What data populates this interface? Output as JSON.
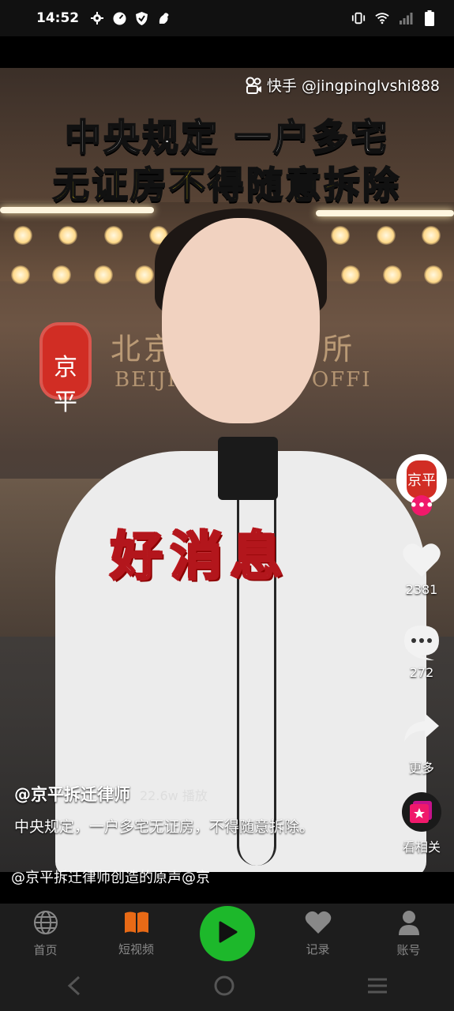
{
  "status_bar": {
    "time": "14:52",
    "left_icons": [
      "settings-icon",
      "speedometer-icon",
      "shield-icon",
      "bird-icon"
    ],
    "right_icons": [
      "vibrate-icon",
      "wifi-icon",
      "signal-icon",
      "battery-icon"
    ]
  },
  "video": {
    "platform_handle": "快手 @jingpinglvshi888",
    "title_line_1": "中央规定 一户多宅",
    "title_line_2": "无证房不得随意拆除",
    "overlay_words": "好消息",
    "wall_sign_cn": "北京   律师事务所",
    "wall_sign_en": "BEIJIN   NG LAW OFFI",
    "logo_text": "京平"
  },
  "actions": {
    "likes": "2381",
    "comments": "272",
    "share_label": "更多",
    "related_label": "看相关"
  },
  "caption": {
    "author": "@京平拆迁律师",
    "plays": "22.6w 播放",
    "description": "中央规定，一户多宅无证房，不得随意拆除。",
    "sound": "@京平拆迁律师创造的原声@京"
  },
  "tabbar": {
    "tabs": [
      {
        "label": "首页",
        "icon": "globe-icon"
      },
      {
        "label": "短视频",
        "icon": "book-icon"
      },
      {
        "label": "",
        "icon": "play-icon"
      },
      {
        "label": "记录",
        "icon": "heart-icon"
      },
      {
        "label": "账号",
        "icon": "person-icon"
      }
    ]
  },
  "colors": {
    "accent_green": "#1db82b",
    "accent_pink": "#f0196b",
    "title_yellow": "#ffe21a",
    "tab_active_orange": "#e86a16"
  }
}
